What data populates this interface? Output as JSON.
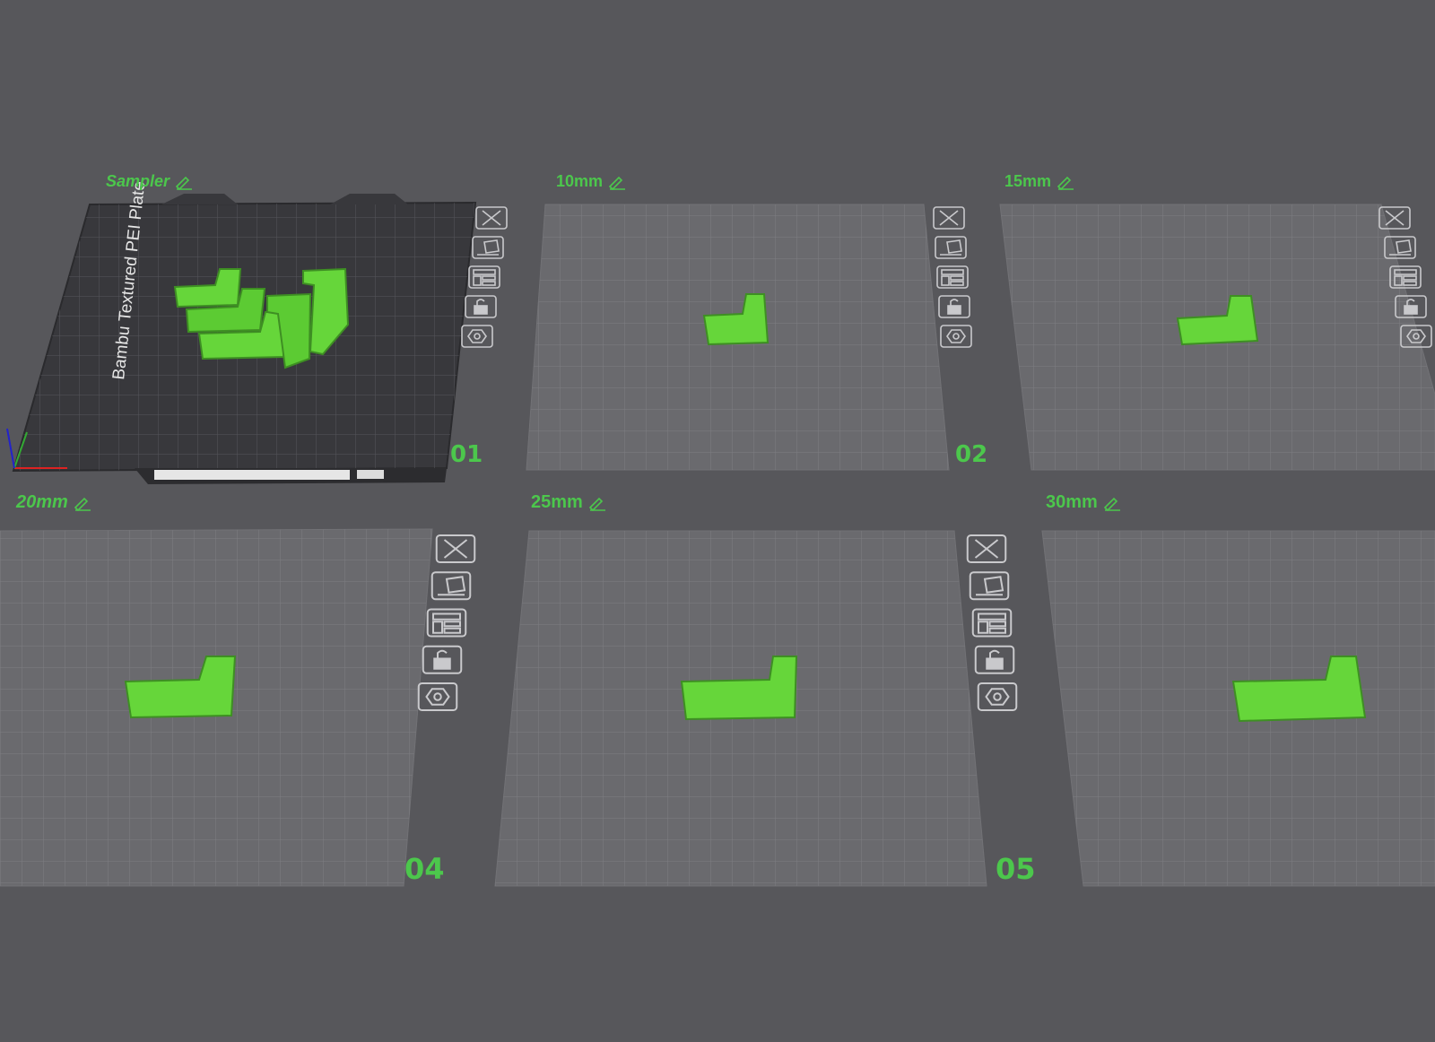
{
  "plates": [
    {
      "name": "Sampler",
      "number": "01",
      "bed_text": "Bambu Textured PEI Plate"
    },
    {
      "name": "10mm",
      "number": "02"
    },
    {
      "name": "15mm",
      "number": ""
    },
    {
      "name": "20mm",
      "number": "04"
    },
    {
      "name": "25mm",
      "number": "05"
    },
    {
      "name": "30mm",
      "number": ""
    }
  ],
  "plate_tools": [
    {
      "name": "close-plate-icon"
    },
    {
      "name": "auto-orient-icon"
    },
    {
      "name": "arrange-icon"
    },
    {
      "name": "lock-icon"
    },
    {
      "name": "plate-settings-icon"
    }
  ],
  "colors": {
    "background": "#57575b",
    "accent_green": "#4cc74c",
    "model_green": "#66d63a",
    "plate_grey": "#6a6a6e",
    "active_plate": "#38383c"
  }
}
